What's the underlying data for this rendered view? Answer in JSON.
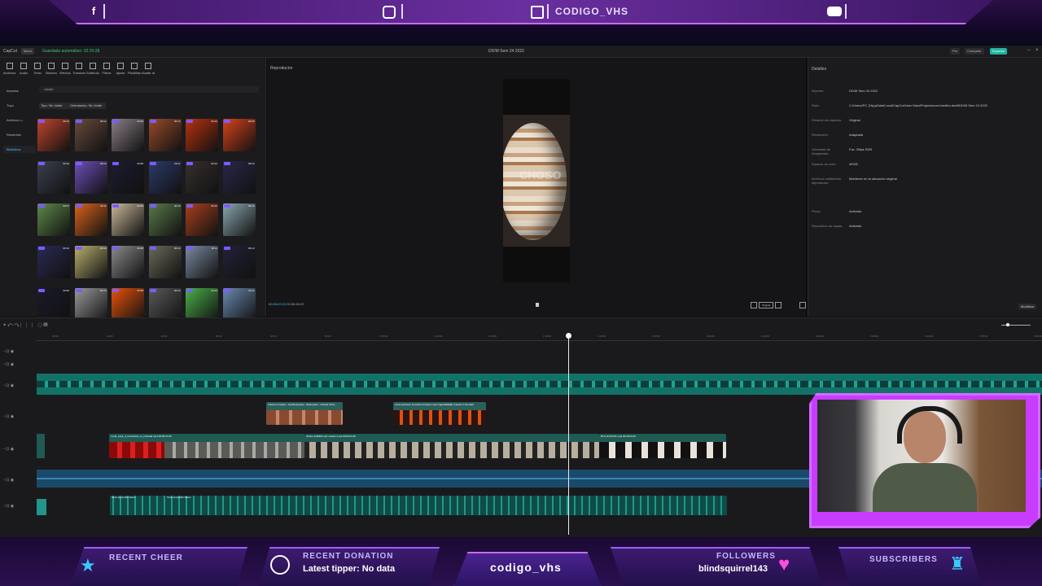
{
  "overlay_top": {
    "icons": [
      "facebook-icon",
      "instagram-icon",
      "twitch-icon",
      "youtube-icon"
    ],
    "handle": "CODIGO_VHS",
    "accent": "#c86cff"
  },
  "app": {
    "title": "DD/M Sem 24 2022",
    "brand": "CapCut",
    "menu": "Menú",
    "autosave": "Guardado automático: 02:20:28",
    "pro_label": "Pro",
    "share_label": "Compartir",
    "export_label": "Exportar"
  },
  "media_panel": {
    "tools": [
      "Archivos multimedia",
      "Audio",
      "Texto",
      "Stickers",
      "Efectos",
      "Transiciones",
      "Subtítulos",
      "Filtros",
      "Ajuste",
      "Plantillas",
      "Avatar de IA"
    ],
    "sidebar": [
      "Importar",
      "Tuyo",
      "Archivos n...",
      "Recientes",
      "Biblioteca"
    ],
    "search": "volcán",
    "filters": [
      "Tipo: Sin límite",
      "Orientación: Sin límite"
    ],
    "thumbs": [
      {
        "dur": "00:12",
        "tone": "#c0452e"
      },
      {
        "dur": "00:12",
        "tone": "#6a4a3c"
      },
      {
        "dur": "00:08",
        "tone": "#8a7f86"
      },
      {
        "dur": "00:15",
        "tone": "#9a4a2a"
      },
      {
        "dur": "00:10",
        "tone": "#b8320f"
      },
      {
        "dur": "00:09",
        "tone": "#d8421a"
      },
      {
        "dur": "00:10",
        "tone": "#3a4150"
      },
      {
        "dur": "00:14",
        "tone": "#6d4fb8"
      },
      {
        "dur": "00:08",
        "tone": "#1c1c30"
      },
      {
        "dur": "00:11",
        "tone": "#2d3a6a"
      },
      {
        "dur": "00:12",
        "tone": "#383030"
      },
      {
        "dur": "00:10",
        "tone": "#28284a"
      },
      {
        "dur": "00:07",
        "tone": "#5e8a4a"
      },
      {
        "dur": "00:11",
        "tone": "#d8631a"
      },
      {
        "dur": "00:09",
        "tone": "#c8b89a"
      },
      {
        "dur": "00:16",
        "tone": "#5a7a4a"
      },
      {
        "dur": "00:12",
        "tone": "#a8401e"
      },
      {
        "dur": "00:10",
        "tone": "#8aa8b0"
      },
      {
        "dur": "00:12",
        "tone": "#2a2a55"
      },
      {
        "dur": "00:10",
        "tone": "#b8b070"
      },
      {
        "dur": "00:08",
        "tone": "#8a8a8a"
      },
      {
        "dur": "00:14",
        "tone": "#6a6a5a"
      },
      {
        "dur": "00:11",
        "tone": "#7a8aa0"
      },
      {
        "dur": "00:13",
        "tone": "#222238"
      },
      {
        "dur": "00:09",
        "tone": "#1a1a2a"
      },
      {
        "dur": "00:10",
        "tone": "#9a9a9a"
      },
      {
        "dur": "00:08",
        "tone": "#e8520a"
      },
      {
        "dur": "00:12",
        "tone": "#5a5a5a"
      },
      {
        "dur": "00:15",
        "tone": "#4ab04a"
      },
      {
        "dur": "00:11",
        "tone": "#6a8ab0"
      }
    ]
  },
  "player": {
    "header": "Reproductor",
    "time_current": "00:06:22:23",
    "time_total": "00:08:46:22",
    "ratio_label": "Original",
    "overlay_text": "CHOSO"
  },
  "details": {
    "header": "Detalles",
    "rows": [
      {
        "k": "Nombre:",
        "v": "DD/M Sem 24 2022"
      },
      {
        "k": "Ruta:",
        "v": "C:/Users/PC 2/AppData/Local/CapCut/User Data/Projects/com.lveditor.draft/DD/M Sem 24 2022"
      },
      {
        "k": "Relación de aspecto:",
        "v": "Original"
      },
      {
        "k": "Resolución:",
        "v": "Adaptada"
      },
      {
        "k": "Velocidad de fotogramas:",
        "v": "Fac. 30fps SDR"
      },
      {
        "k": "Espacio de color:",
        "v": "sRGB"
      },
      {
        "k": "Archivos multimedia importados:",
        "v": "Mantener en la ubicación original"
      },
      {
        "k": "Proxy:",
        "v": "Activado"
      },
      {
        "k": "Reposición de capas:",
        "v": "Activado"
      }
    ],
    "modify": "Modificar"
  },
  "timeline": {
    "ruler": [
      "00:00",
      "10:00",
      "20:00",
      "30:00",
      "40:00",
      "50:00",
      "1:00:00",
      "1:10:00",
      "1:20:00",
      "1:30:00",
      "1:40:00",
      "1:50:00",
      "2:00:00",
      "2:10:00",
      "2:20:00",
      "2:30:00",
      "2:40:00",
      "2:50:00",
      "3:00:00"
    ],
    "clip_labels": [
      "Volcano eruption - Geothypuebes - Rayleywan - Iceland Orths",
      "Lava explosion at iceland eruption near Fagradalsfjall, Iceland in the dark",
      "Local_Lava_4_tramofuelo_in_probada.mp4  00:00:07:00",
      "NASA-JU0085.mp4  medium.mp4  00:00:04:20",
      "BTS-JUNO/P1.mp4  00:00:04:20",
      "Texto al escribir Adam",
      "Texto al escribir Adam"
    ]
  },
  "overlay_bottom": {
    "recent_cheer": "RECENT CHEER",
    "recent_donation": "RECENT DONATION",
    "donation_value": "Latest tipper: No data",
    "channel": "codigo_vhs",
    "followers": "FOLLOWERS",
    "follower_value": "blindsquirrel143",
    "subscribers": "SUBSCRIBERS",
    "accent": "#9f5cff",
    "heart": "#ff4fd8",
    "star": "#38c8ff"
  }
}
